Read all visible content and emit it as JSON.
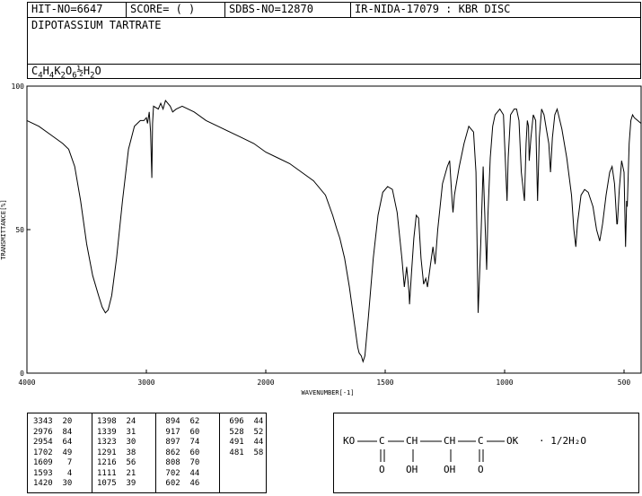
{
  "header": {
    "hit_no": "HIT-NO=6647",
    "score": "SCORE=  (   )",
    "sdbs_no": "SDBS-NO=12870",
    "ir_info": "IR-NIDA-17079 : KBR DISC",
    "compound_name": "DIPOTASSIUM TARTRATE",
    "formula_parts": [
      "C",
      "4",
      "H",
      "4",
      "K",
      "2",
      "O",
      "6",
      "½",
      "H",
      "2",
      "O"
    ]
  },
  "chart_data": {
    "type": "line",
    "xlabel": "WAVENUMBER[-1]",
    "ylabel": "TRANSMITTANCE[%]",
    "xlim": [
      4000,
      400
    ],
    "ylim": [
      0,
      100
    ],
    "x_ticks": [
      "4000",
      "3000",
      "2000",
      "1500",
      "1000",
      "500"
    ],
    "y_ticks": [
      "100",
      "50",
      "0"
    ],
    "series": [
      {
        "points": [
          [
            4000,
            88
          ],
          [
            3900,
            86
          ],
          [
            3800,
            83
          ],
          [
            3700,
            80
          ],
          [
            3650,
            78
          ],
          [
            3600,
            72
          ],
          [
            3550,
            60
          ],
          [
            3500,
            45
          ],
          [
            3450,
            34
          ],
          [
            3400,
            27
          ],
          [
            3370,
            23
          ],
          [
            3343,
            21
          ],
          [
            3320,
            22
          ],
          [
            3290,
            27
          ],
          [
            3250,
            40
          ],
          [
            3200,
            60
          ],
          [
            3150,
            78
          ],
          [
            3100,
            86
          ],
          [
            3050,
            88
          ],
          [
            3020,
            88
          ],
          [
            3000,
            89
          ],
          [
            2990,
            87
          ],
          [
            2976,
            91
          ],
          [
            2965,
            84
          ],
          [
            2954,
            68
          ],
          [
            2948,
            87
          ],
          [
            2940,
            93
          ],
          [
            2900,
            92
          ],
          [
            2880,
            94
          ],
          [
            2860,
            92
          ],
          [
            2840,
            95
          ],
          [
            2800,
            93
          ],
          [
            2780,
            91
          ],
          [
            2750,
            92
          ],
          [
            2700,
            93
          ],
          [
            2600,
            91
          ],
          [
            2500,
            88
          ],
          [
            2400,
            86
          ],
          [
            2300,
            84
          ],
          [
            2200,
            82
          ],
          [
            2100,
            80
          ],
          [
            2000,
            77
          ],
          [
            1950,
            75
          ],
          [
            1900,
            73
          ],
          [
            1850,
            70
          ],
          [
            1800,
            67
          ],
          [
            1750,
            62
          ],
          [
            1720,
            55
          ],
          [
            1702,
            50
          ],
          [
            1690,
            47
          ],
          [
            1670,
            40
          ],
          [
            1650,
            30
          ],
          [
            1630,
            18
          ],
          [
            1615,
            9
          ],
          [
            1609,
            7
          ],
          [
            1600,
            6
          ],
          [
            1593,
            4
          ],
          [
            1585,
            6
          ],
          [
            1570,
            20
          ],
          [
            1550,
            40
          ],
          [
            1530,
            55
          ],
          [
            1510,
            63
          ],
          [
            1490,
            65
          ],
          [
            1470,
            64
          ],
          [
            1450,
            56
          ],
          [
            1430,
            40
          ],
          [
            1420,
            30
          ],
          [
            1410,
            37
          ],
          [
            1400,
            28
          ],
          [
            1398,
            24
          ],
          [
            1390,
            35
          ],
          [
            1380,
            47
          ],
          [
            1370,
            55
          ],
          [
            1360,
            54
          ],
          [
            1350,
            40
          ],
          [
            1339,
            31
          ],
          [
            1330,
            33
          ],
          [
            1323,
            30
          ],
          [
            1310,
            38
          ],
          [
            1300,
            44
          ],
          [
            1291,
            38
          ],
          [
            1280,
            50
          ],
          [
            1260,
            66
          ],
          [
            1240,
            72
          ],
          [
            1230,
            74
          ],
          [
            1220,
            60
          ],
          [
            1216,
            56
          ],
          [
            1210,
            62
          ],
          [
            1190,
            72
          ],
          [
            1170,
            80
          ],
          [
            1150,
            86
          ],
          [
            1130,
            84
          ],
          [
            1120,
            70
          ],
          [
            1111,
            21
          ],
          [
            1100,
            45
          ],
          [
            1090,
            72
          ],
          [
            1080,
            48
          ],
          [
            1075,
            36
          ],
          [
            1070,
            55
          ],
          [
            1060,
            75
          ],
          [
            1050,
            86
          ],
          [
            1040,
            90
          ],
          [
            1020,
            92
          ],
          [
            1005,
            90
          ],
          [
            1000,
            80
          ],
          [
            990,
            60
          ],
          [
            985,
            75
          ],
          [
            975,
            90
          ],
          [
            960,
            92
          ],
          [
            950,
            92
          ],
          [
            940,
            88
          ],
          [
            930,
            70
          ],
          [
            917,
            60
          ],
          [
            910,
            80
          ],
          [
            905,
            88
          ],
          [
            900,
            86
          ],
          [
            897,
            74
          ],
          [
            890,
            82
          ],
          [
            880,
            90
          ],
          [
            870,
            88
          ],
          [
            862,
            60
          ],
          [
            855,
            82
          ],
          [
            845,
            92
          ],
          [
            835,
            90
          ],
          [
            825,
            85
          ],
          [
            815,
            80
          ],
          [
            808,
            70
          ],
          [
            800,
            82
          ],
          [
            790,
            90
          ],
          [
            780,
            92
          ],
          [
            760,
            85
          ],
          [
            740,
            75
          ],
          [
            720,
            62
          ],
          [
            710,
            50
          ],
          [
            702,
            44
          ],
          [
            695,
            52
          ],
          [
            680,
            62
          ],
          [
            665,
            64
          ],
          [
            650,
            63
          ],
          [
            630,
            58
          ],
          [
            615,
            50
          ],
          [
            602,
            46
          ],
          [
            590,
            52
          ],
          [
            575,
            62
          ],
          [
            560,
            70
          ],
          [
            550,
            72
          ],
          [
            540,
            66
          ],
          [
            530,
            52
          ],
          [
            528,
            52
          ],
          [
            520,
            64
          ],
          [
            510,
            74
          ],
          [
            500,
            70
          ],
          [
            491,
            44
          ],
          [
            485,
            60
          ],
          [
            481,
            58
          ],
          [
            470,
            80
          ],
          [
            460,
            88
          ],
          [
            450,
            90
          ],
          [
            440,
            89
          ],
          [
            420,
            88
          ],
          [
            400,
            87
          ]
        ]
      }
    ]
  },
  "peaks": [
    [
      [
        "3343",
        "20"
      ],
      [
        "2976",
        "84"
      ],
      [
        "2954",
        "64"
      ],
      [
        "1702",
        "49"
      ],
      [
        "1609",
        "7"
      ],
      [
        "1593",
        "4"
      ],
      [
        "1420",
        "30"
      ]
    ],
    [
      [
        "1398",
        "24"
      ],
      [
        "1339",
        "31"
      ],
      [
        "1323",
        "30"
      ],
      [
        "1291",
        "38"
      ],
      [
        "1216",
        "56"
      ],
      [
        "1111",
        "21"
      ],
      [
        "1075",
        "39"
      ]
    ],
    [
      [
        "894",
        "62"
      ],
      [
        "917",
        "60"
      ],
      [
        "897",
        "74"
      ],
      [
        "862",
        "60"
      ],
      [
        "808",
        "70"
      ],
      [
        "702",
        "44"
      ],
      [
        "602",
        "46"
      ]
    ],
    [
      [
        "696",
        "44"
      ],
      [
        "528",
        "52"
      ],
      [
        "491",
        "44"
      ],
      [
        "481",
        "58"
      ]
    ]
  ],
  "structure": {
    "ko": "KO",
    "ok": "OK",
    "c": "C",
    "ch": "CH",
    "o": "O",
    "oh": "OH",
    "salt": "·  1/2H₂O"
  }
}
